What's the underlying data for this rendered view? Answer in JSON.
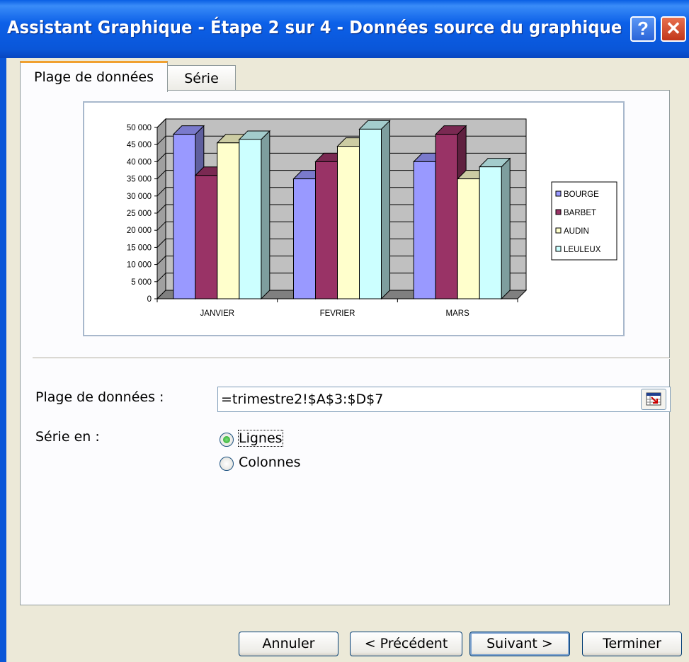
{
  "window": {
    "title": "Assistant Graphique - Étape 2 sur 4 - Données source du graphique",
    "help_glyph": "?",
    "close_glyph": "✕"
  },
  "tabs": [
    {
      "label": "Plage de données",
      "active": true
    },
    {
      "label": "Série",
      "active": false
    }
  ],
  "chart_data": {
    "type": "bar",
    "style": "3d-clustered-column",
    "categories": [
      "JANVIER",
      "FEVRIER",
      "MARS"
    ],
    "series": [
      {
        "name": "BOURGE",
        "color": "#9999ff",
        "values": [
          48000,
          35000,
          40000
        ]
      },
      {
        "name": "BARBET",
        "color": "#993366",
        "values": [
          36000,
          40000,
          48000
        ]
      },
      {
        "name": "AUDIN",
        "color": "#ffffcc",
        "values": [
          45500,
          44500,
          35000
        ]
      },
      {
        "name": "LEULEUX",
        "color": "#ccffff",
        "values": [
          46500,
          49500,
          38500
        ]
      }
    ],
    "y_ticks": [
      "50 000",
      "45 000",
      "40 000",
      "35 000",
      "30 000",
      "25 000",
      "20 000",
      "15 000",
      "10 000",
      "5 000",
      "0"
    ],
    "ylim": [
      0,
      50000
    ],
    "grid": true,
    "legend": "right",
    "wall_color": "#c0c0c0",
    "floor_color": "#808080"
  },
  "form": {
    "range_label": "Plage de données :",
    "range_value": "=trimestre2!$A$3:$D$7",
    "series_in_label": "Série en :",
    "options": [
      {
        "label": "Lignes",
        "selected": true
      },
      {
        "label": "Colonnes",
        "selected": false
      }
    ]
  },
  "buttons": {
    "cancel": "Annuler",
    "previous": "< Précédent",
    "next": "Suivant >",
    "finish": "Terminer"
  }
}
